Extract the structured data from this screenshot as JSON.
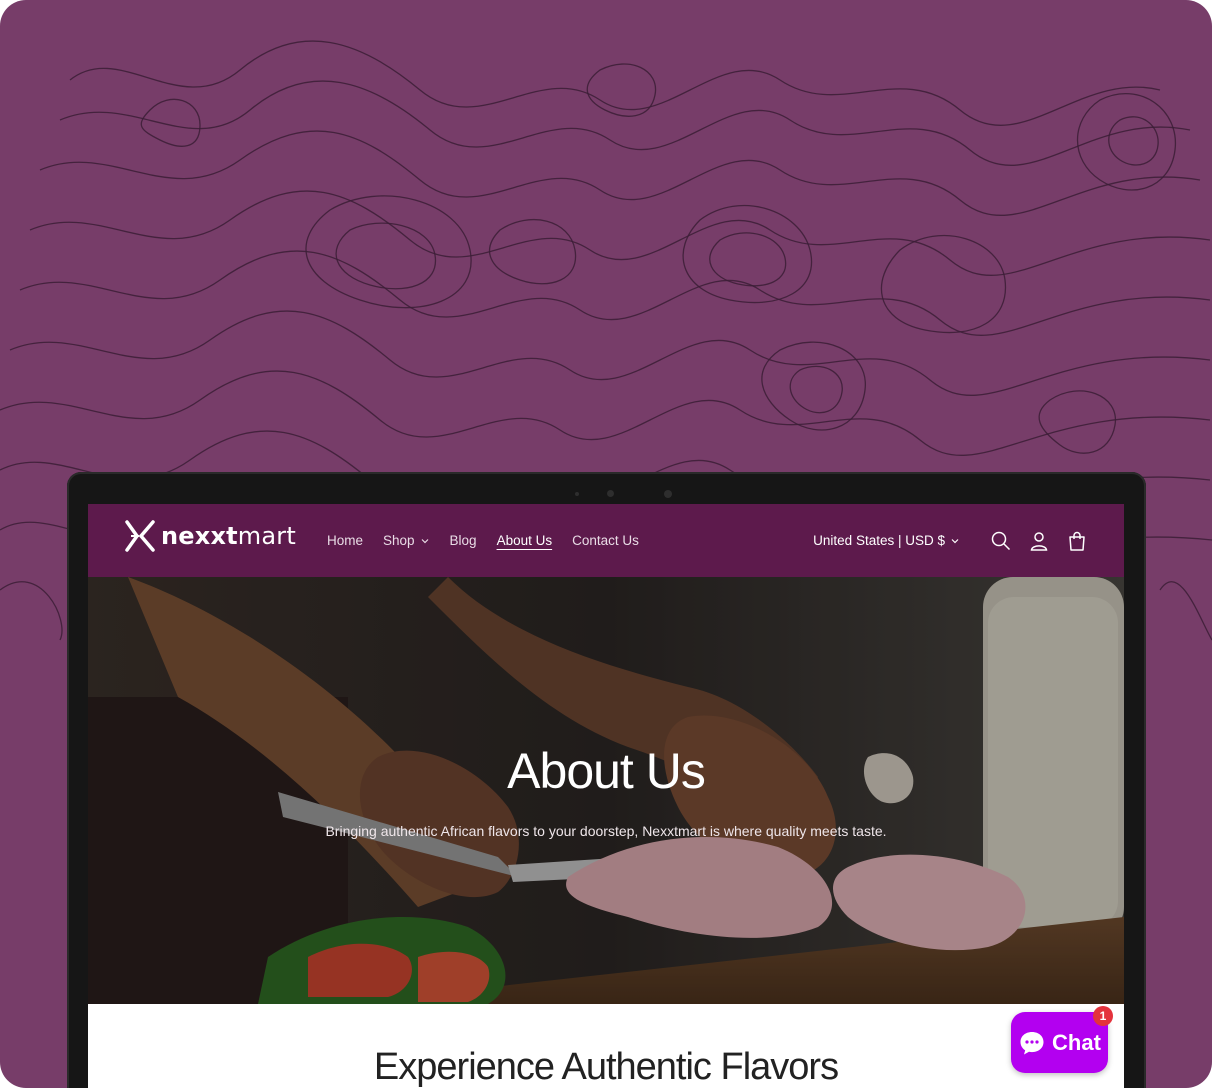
{
  "site": {
    "logo_text_bold": "nexxt",
    "logo_text_light": "mart"
  },
  "nav": {
    "items": [
      {
        "label": "Home"
      },
      {
        "label": "Shop",
        "has_dropdown": true
      },
      {
        "label": "Blog"
      },
      {
        "label": "About Us",
        "active": true
      },
      {
        "label": "Contact Us"
      }
    ],
    "currency": "United States | USD $",
    "icons": [
      "search-icon",
      "account-icon",
      "cart-icon"
    ]
  },
  "hero": {
    "title": "About Us",
    "subtitle": "Bringing authentic African flavors to your doorstep, Nexxtmart is where quality meets taste."
  },
  "section": {
    "title": "Experience Authentic Flavors"
  },
  "chat": {
    "label": "Chat",
    "badge_count": "1"
  },
  "colors": {
    "background": "#773d69",
    "navbar": "#5d1a4c",
    "chat_button": "#b300f0",
    "badge": "#e4323c"
  }
}
